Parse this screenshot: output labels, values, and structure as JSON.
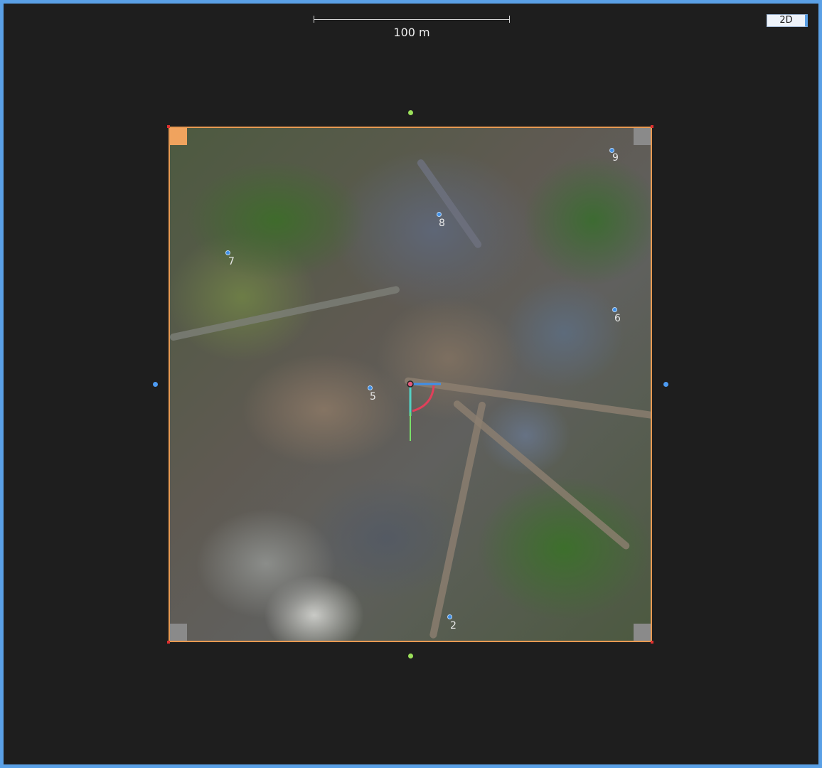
{
  "toolbar": {
    "view_mode_label": "2D"
  },
  "scale_bar": {
    "label": "100 m"
  },
  "gcp_markers": [
    {
      "label": "9"
    },
    {
      "label": "8"
    },
    {
      "label": "7"
    },
    {
      "label": "6"
    },
    {
      "label": "5"
    },
    {
      "label": "2"
    }
  ],
  "colors": {
    "viewport_border": "#5aa0e6",
    "selection_border": "#e89a52",
    "background": "#1e1e1e",
    "handle_green": "#9be05a",
    "handle_blue": "#4d9bf2"
  }
}
